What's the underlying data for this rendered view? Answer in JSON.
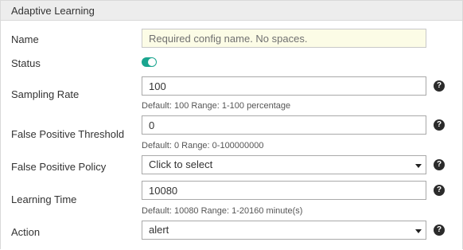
{
  "panel": {
    "title": "Adaptive Learning"
  },
  "fields": {
    "name": {
      "label": "Name",
      "value": "",
      "placeholder": "Required config name. No spaces."
    },
    "status": {
      "label": "Status",
      "enabled": true
    },
    "sampling_rate": {
      "label": "Sampling Rate",
      "value": "100",
      "hint": "Default: 100 Range: 1-100 percentage"
    },
    "false_positive_threshold": {
      "label": "False Positive Threshold",
      "value": "0",
      "hint": "Default: 0 Range: 0-100000000"
    },
    "false_positive_policy": {
      "label": "False Positive Policy",
      "selected": "Click to select"
    },
    "learning_time": {
      "label": "Learning Time",
      "value": "10080",
      "hint": "Default: 10080 Range: 1-20160 minute(s)"
    },
    "action": {
      "label": "Action",
      "selected": "alert"
    }
  },
  "help_icon": {
    "glyph": "?"
  },
  "colors": {
    "toggle_on": "#1aa58f",
    "name_field_bg": "#fcfce6",
    "header_bg": "#ededed"
  }
}
